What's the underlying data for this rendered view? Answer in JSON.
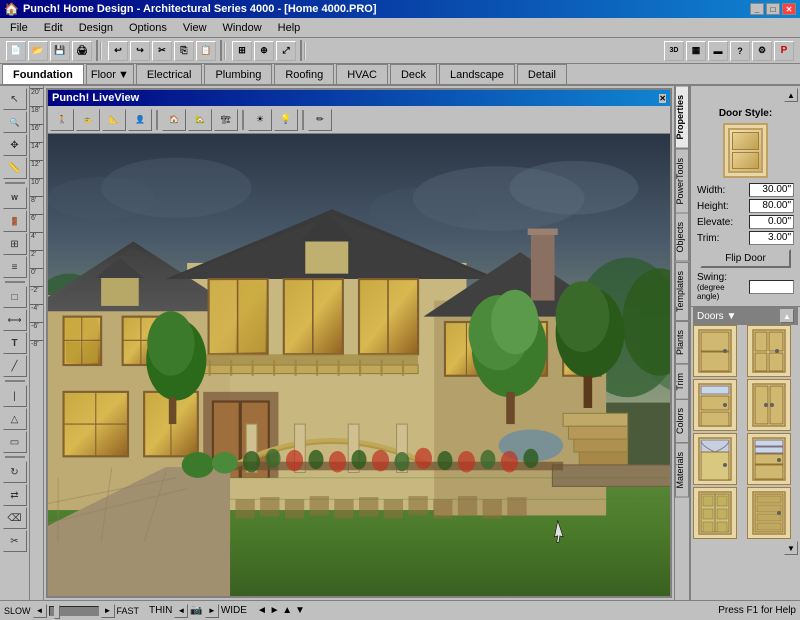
{
  "titlebar": {
    "title": "Punch! Home Design - Architectural Series 4000 - [Home 4000.PRO]",
    "controls": [
      "minimize",
      "maximize",
      "close"
    ]
  },
  "menubar": {
    "items": [
      "File",
      "Edit",
      "Design",
      "Options",
      "View",
      "Window",
      "Help"
    ]
  },
  "toolbar": {
    "buttons": [
      "new",
      "open",
      "save",
      "print",
      "undo",
      "redo",
      "grid",
      "snap",
      "zoom-in",
      "zoom-out"
    ]
  },
  "tabs": {
    "items": [
      "Foundation",
      "Floor ▼",
      "Electrical",
      "Plumbing",
      "Roofing",
      "HVAC",
      "Deck",
      "Landscape",
      "Detail"
    ],
    "active": "Foundation"
  },
  "liveview": {
    "title": "Punch! LiveView",
    "toolbar_buttons": [
      "walk",
      "helicopter",
      "elevation",
      "person",
      "house",
      "camera-tools",
      "sun",
      "light",
      "pencil"
    ]
  },
  "left_toolbar": {
    "tools": [
      "select",
      "zoom",
      "pan",
      "line",
      "rect",
      "circle",
      "text",
      "dimension",
      "erase",
      "move",
      "rotate",
      "mirror",
      "trim",
      "extend",
      "fillet",
      "stairs",
      "roof",
      "wall",
      "door",
      "window",
      "column",
      "beam"
    ]
  },
  "right_panel": {
    "door_style_label": "Door Style:",
    "properties": {
      "width_label": "Width:",
      "width_value": "30.00\"",
      "height_label": "Height:",
      "height_value": "80.00\"",
      "elevate_label": "Elevate:",
      "elevate_value": "0.00\"",
      "trim_label": "Trim:",
      "trim_value": "3.00\""
    },
    "flip_door_label": "Flip Door",
    "swing_label": "Swing:",
    "swing_sublabel": "(degree angle)"
  },
  "side_tabs": {
    "items": [
      "Properties",
      "PowerTools",
      "Objects",
      "Templates",
      "Plants",
      "Trim",
      "Colors",
      "Materials"
    ]
  },
  "doors_section": {
    "label": "Doors ▼",
    "thumbnails": [
      "door1",
      "door2",
      "door3",
      "door4",
      "door5",
      "door6",
      "door7",
      "door8"
    ]
  },
  "scale_marks": [
    "20'",
    "18'",
    "16'",
    "14'",
    "12'",
    "10'",
    "8'",
    "6'",
    "4'",
    "2'",
    "0'",
    "-2'",
    "-4'",
    "-6'",
    "-8'"
  ],
  "bottom_bar": {
    "speed_slow": "SLOW",
    "speed_fast": "FAST",
    "thin_label": "THIN",
    "wide_label": "WIDE",
    "status": "Press F1 for Help"
  }
}
